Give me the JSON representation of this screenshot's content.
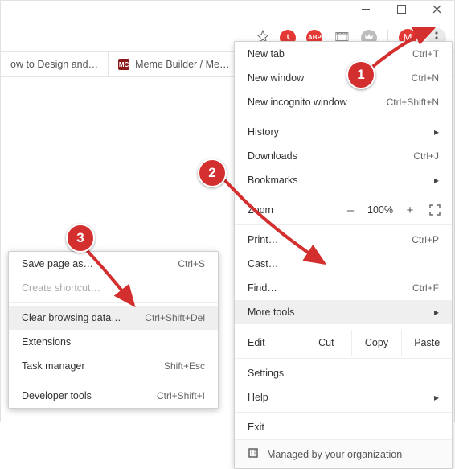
{
  "titlebar": {
    "min": "—",
    "max": "▢",
    "close": "✕"
  },
  "toolbar": {
    "avatar_letter": "M",
    "ext1_letter": "",
    "abp_text": "ABP",
    "runner_letter": "⇪",
    "film_emoji": "🎞"
  },
  "tabs": [
    {
      "label": "ow to Design and…",
      "favicon": ""
    },
    {
      "label": "Meme Builder / Me…",
      "favicon": "MC"
    }
  ],
  "menu": {
    "new_tab": {
      "label": "New tab",
      "short": "Ctrl+T"
    },
    "new_window": {
      "label": "New window",
      "short": "Ctrl+N"
    },
    "incognito": {
      "label": "New incognito window",
      "short": "Ctrl+Shift+N"
    },
    "history": {
      "label": "History"
    },
    "downloads": {
      "label": "Downloads",
      "short": "Ctrl+J"
    },
    "bookmarks": {
      "label": "Bookmarks"
    },
    "zoom": {
      "label": "Zoom",
      "value": "100%",
      "minus": "–",
      "plus": "+"
    },
    "print": {
      "label": "Print…",
      "short": "Ctrl+P"
    },
    "cast": {
      "label": "Cast…"
    },
    "find": {
      "label": "Find…",
      "short": "Ctrl+F"
    },
    "more_tools": {
      "label": "More tools"
    },
    "edit": {
      "label": "Edit",
      "cut": "Cut",
      "copy": "Copy",
      "paste": "Paste"
    },
    "settings": {
      "label": "Settings"
    },
    "help": {
      "label": "Help"
    },
    "exit": {
      "label": "Exit"
    },
    "managed": {
      "label": "Managed by your organization"
    }
  },
  "submenu": {
    "save": {
      "label": "Save page as…",
      "short": "Ctrl+S"
    },
    "create": {
      "label": "Create shortcut…"
    },
    "clear": {
      "label": "Clear browsing data…",
      "short": "Ctrl+Shift+Del"
    },
    "ext": {
      "label": "Extensions"
    },
    "task": {
      "label": "Task manager",
      "short": "Shift+Esc"
    },
    "dev": {
      "label": "Developer tools",
      "short": "Ctrl+Shift+I"
    }
  },
  "steps": {
    "s1": "1",
    "s2": "2",
    "s3": "3"
  }
}
